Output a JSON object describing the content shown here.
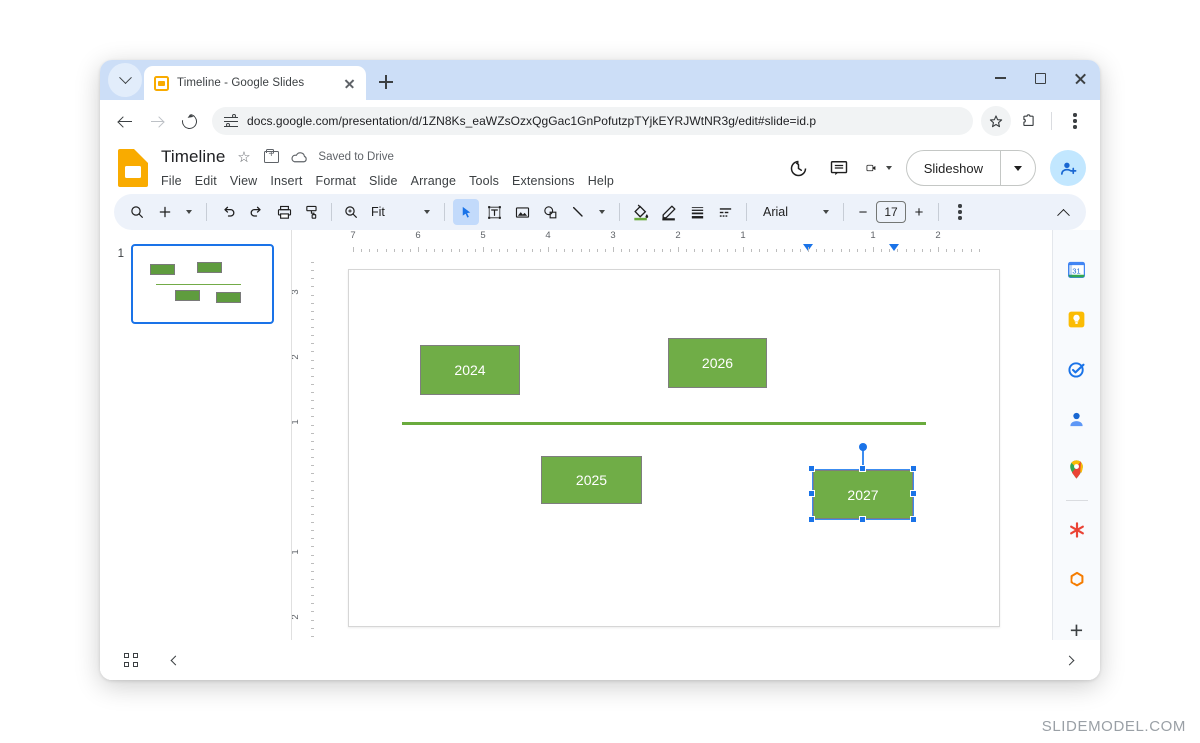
{
  "browser": {
    "tab": {
      "title": "Timeline - Google Slides",
      "favicon": "slides-favicon",
      "close": "×"
    },
    "new_tab_label": "+",
    "url": "docs.google.com/presentation/d/1ZN8Ks_eaWZsOzxQgGac1GnPofutzpTYjkEYRJWtNR3g/edit#slide=id.p",
    "window_controls": {
      "minimize": "minimize-icon",
      "maximize": "maximize-icon",
      "close": "close-icon"
    }
  },
  "app": {
    "doc_title": "Timeline",
    "save_status": "Saved to Drive",
    "menu": [
      "File",
      "Edit",
      "View",
      "Insert",
      "Format",
      "Slide",
      "Arrange",
      "Tools",
      "Extensions",
      "Help"
    ],
    "header_actions": {
      "slideshow_label": "Slideshow"
    }
  },
  "toolbar": {
    "zoom_label": "Fit",
    "font_name": "Arial",
    "font_size": "17"
  },
  "filmstrip": {
    "slides": [
      {
        "number": "1"
      }
    ]
  },
  "rulers": {
    "horizontal_labels": [
      "7",
      "6",
      "5",
      "4",
      "3",
      "2",
      "1",
      "1",
      "2"
    ],
    "vertical_labels": [
      "3",
      "2",
      "1",
      "1",
      "2"
    ]
  },
  "slide": {
    "shapes": [
      {
        "label": "2024",
        "selected": false
      },
      {
        "label": "2026",
        "selected": false
      },
      {
        "label": "2025",
        "selected": false
      },
      {
        "label": "2027",
        "selected": true
      }
    ],
    "timeline_color": "#6aab3d",
    "shape_fill": "#70ad47"
  },
  "rail": {
    "items": [
      {
        "name": "calendar",
        "label": "31"
      },
      {
        "name": "keep",
        "label": ""
      },
      {
        "name": "tasks",
        "label": ""
      },
      {
        "name": "contacts",
        "label": ""
      },
      {
        "name": "maps",
        "label": ""
      },
      {
        "name": "asterisk-addon",
        "label": ""
      },
      {
        "name": "aodocs-addon",
        "label": ""
      }
    ],
    "add_label": "+"
  },
  "footer": {
    "grid_view": "grid-view-icon",
    "prev": "‹",
    "next": "›"
  },
  "watermark": "SLIDEMODEL.COM"
}
